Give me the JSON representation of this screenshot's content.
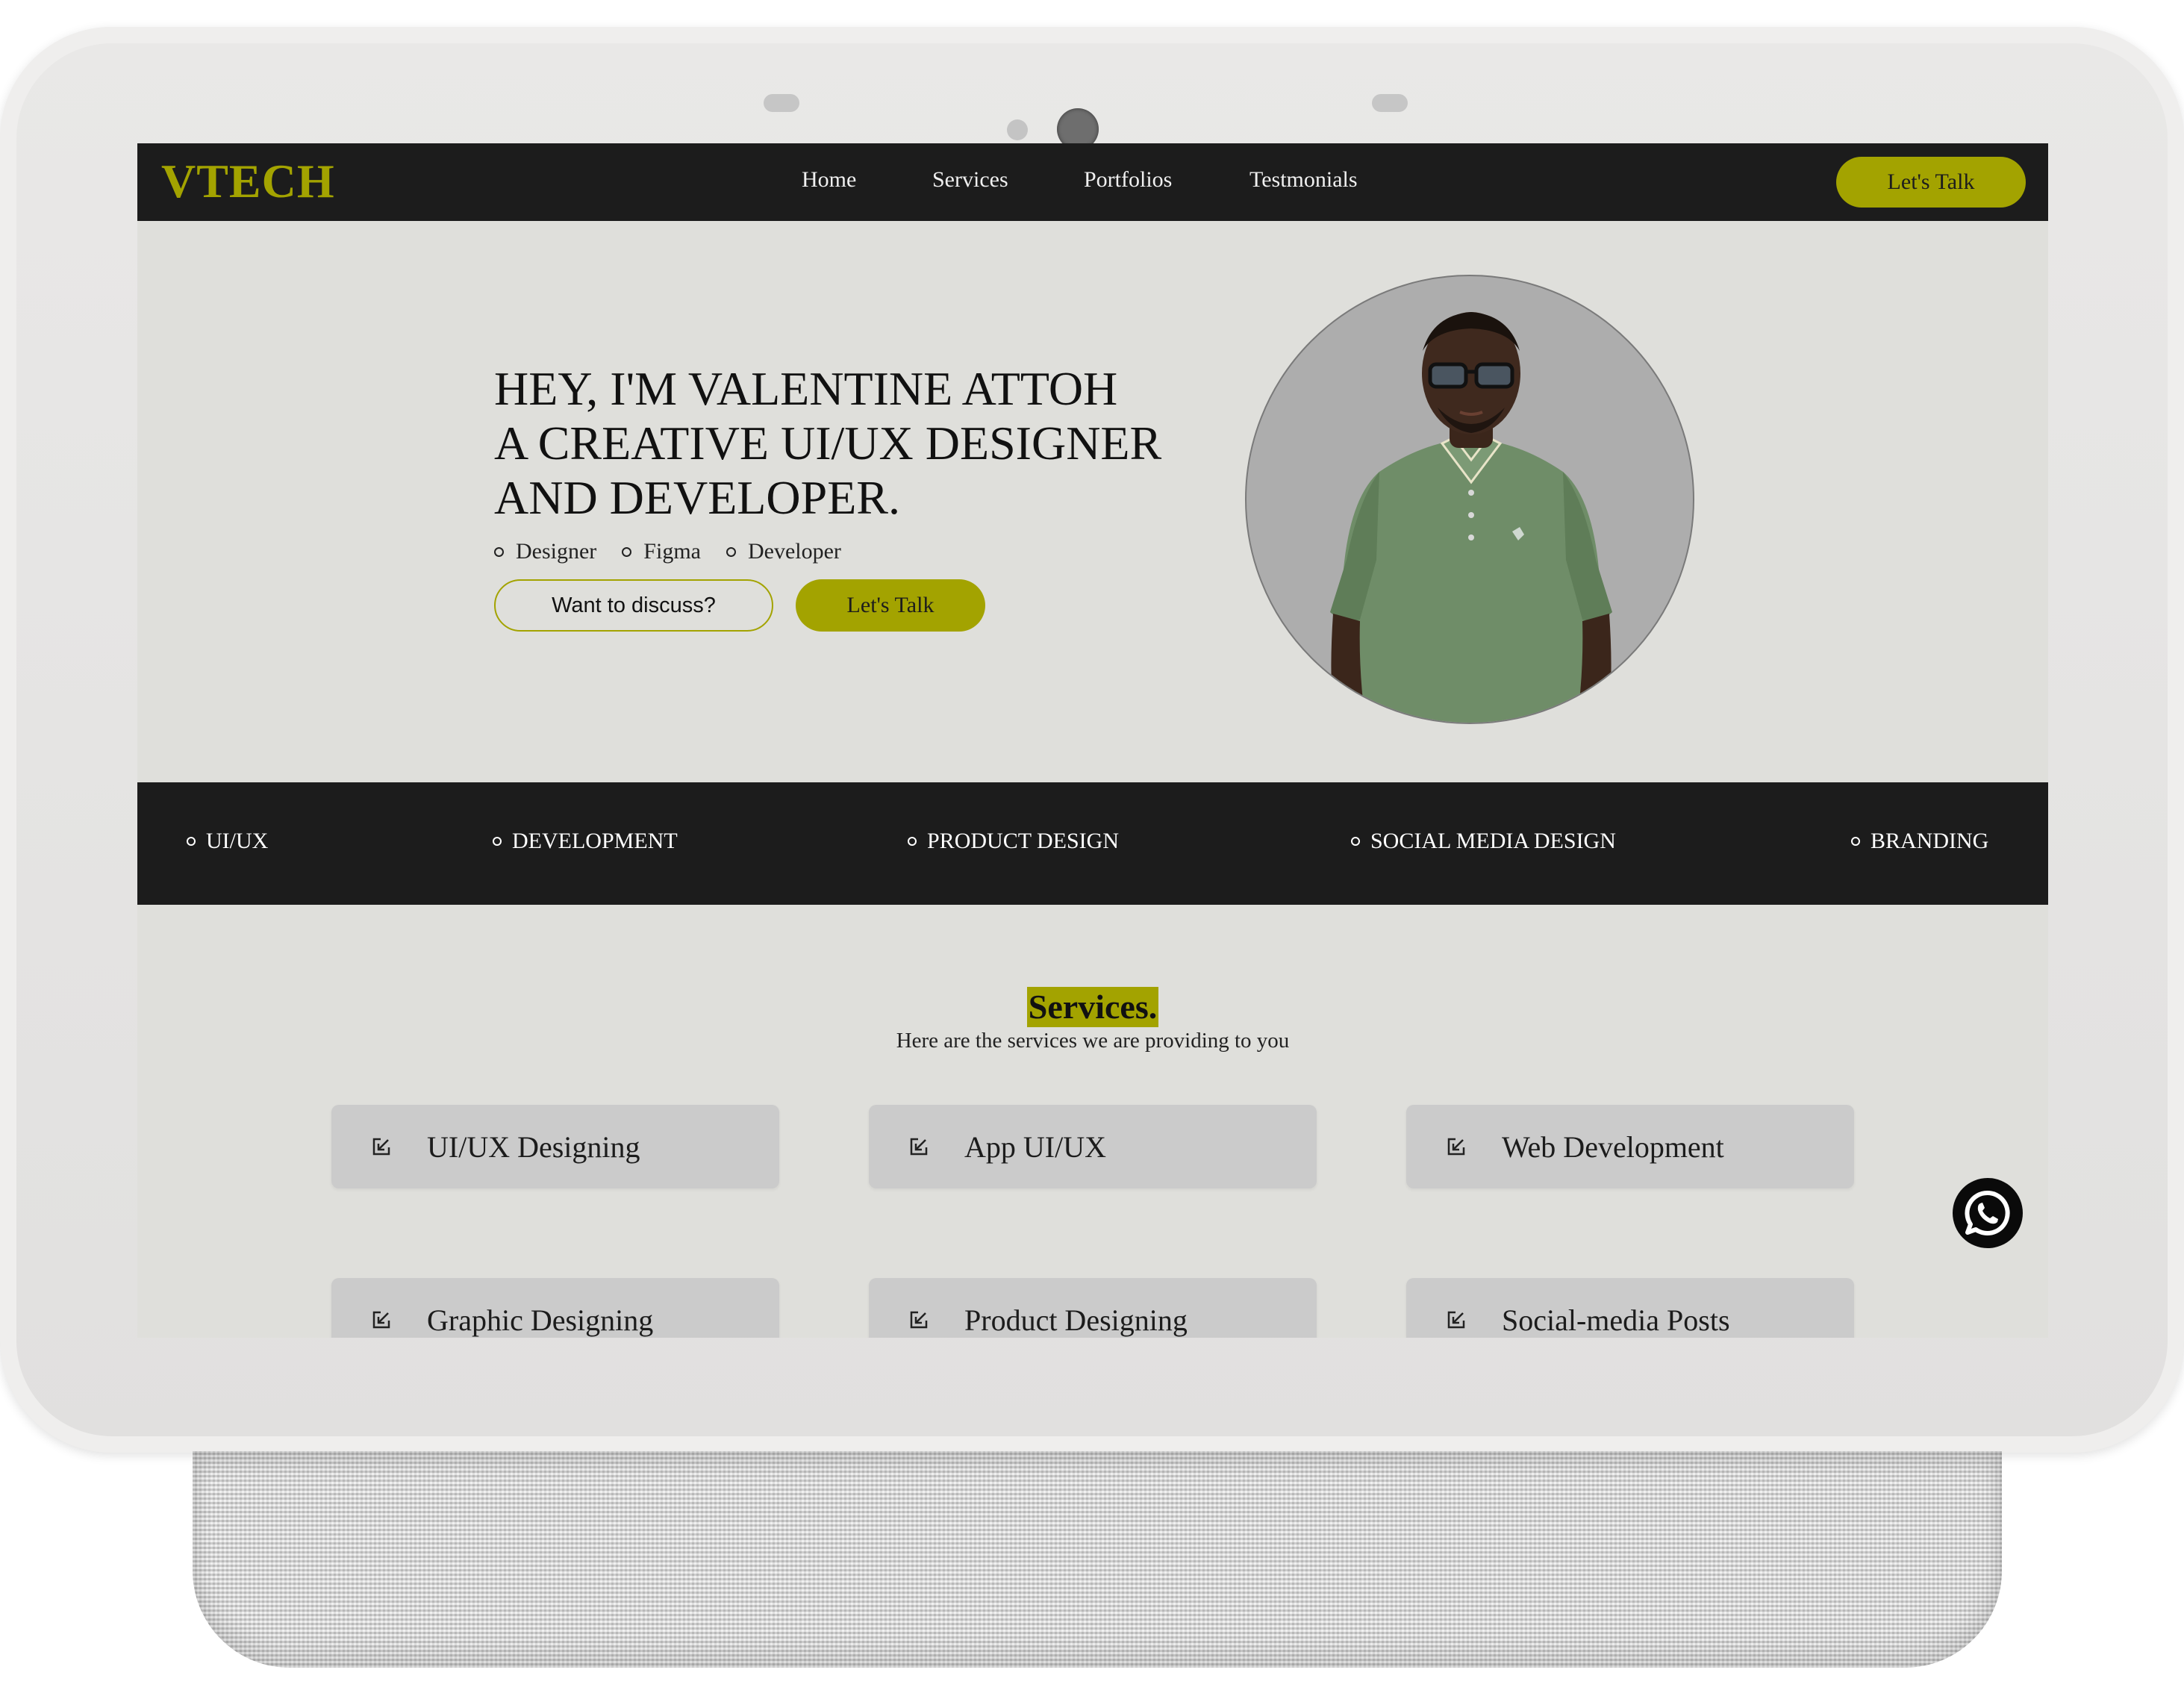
{
  "nav": {
    "logo": "VTECH",
    "links": [
      "Home",
      "Services",
      "Portfolios",
      "Testmonials"
    ],
    "cta": "Let's Talk"
  },
  "hero": {
    "heading_lines": [
      "HEY, I'M VALENTINE ATTOH",
      "A CREATIVE UI/UX DESIGNER",
      "AND DEVELOPER."
    ],
    "tags": [
      "Designer",
      "Figma",
      "Developer"
    ],
    "secondary_button": "Want to discuss?",
    "primary_button": "Let's Talk"
  },
  "band": {
    "items": [
      "UI/UX",
      "DEVELOPMENT",
      "PRODUCT DESIGN",
      "SOCIAL MEDIA DESIGN",
      "BRANDING"
    ]
  },
  "services": {
    "title": "Services.",
    "subtitle": "Here are the services we are providing to you",
    "cards": [
      "UI/UX Designing",
      "App UI/UX",
      "Web Development",
      "Graphic Designing",
      "Product Designing",
      "Social-media Posts"
    ]
  },
  "icons": {
    "card_icon": "arrow-down-left-box-icon",
    "chat_icon": "whatsapp-icon"
  },
  "colors": {
    "accent": "#a3a300",
    "dark": "#1c1c1c",
    "background": "#dfdfdb",
    "card": "#cbcbcb"
  }
}
